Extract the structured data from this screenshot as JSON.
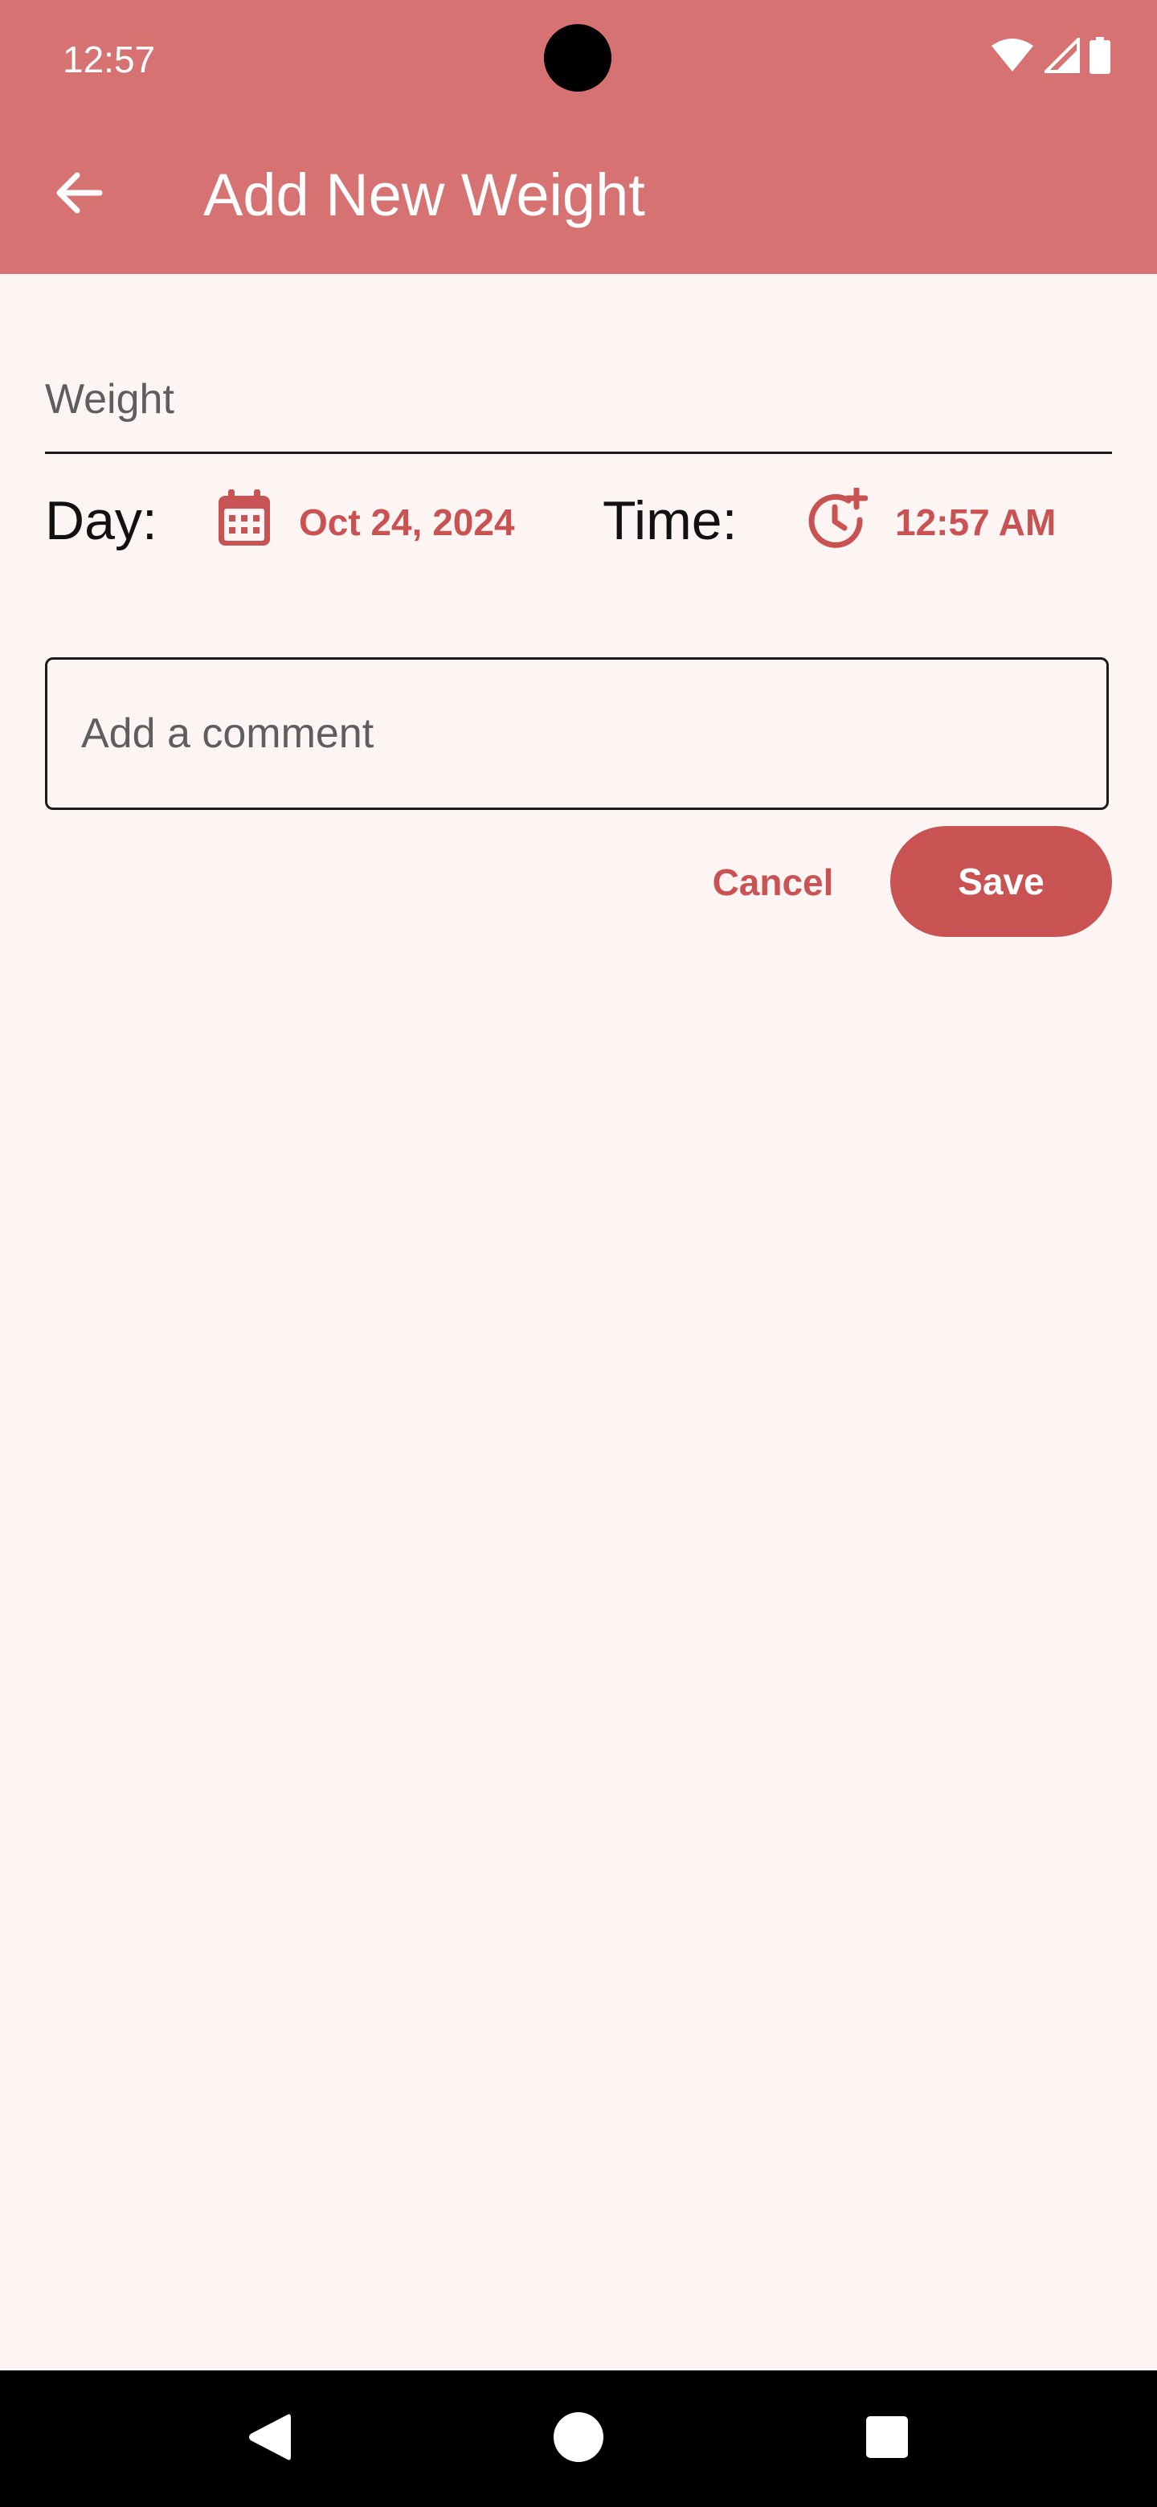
{
  "status_bar": {
    "time": "12:57",
    "icons": [
      "wifi-icon",
      "signal-icon",
      "battery-icon"
    ]
  },
  "app_bar": {
    "back_icon": "arrow-back-icon",
    "title": "Add New Weight"
  },
  "form": {
    "weight_placeholder": "Weight",
    "day_label": "Day:",
    "date_value": "Oct 24, 2024",
    "date_icon": "calendar-icon",
    "time_label": "Time:",
    "time_value": "12:57 AM",
    "time_icon": "clock-add-icon",
    "comment_placeholder": "Add a comment"
  },
  "actions": {
    "cancel_label": "Cancel",
    "save_label": "Save"
  },
  "nav_bar": {
    "icons": [
      "back-triangle-icon",
      "home-circle-icon",
      "recents-square-icon"
    ]
  },
  "colors": {
    "app_bar": "#d67372",
    "accent": "#c95353",
    "background": "#fdf4f4",
    "nav_bar": "#000000"
  }
}
